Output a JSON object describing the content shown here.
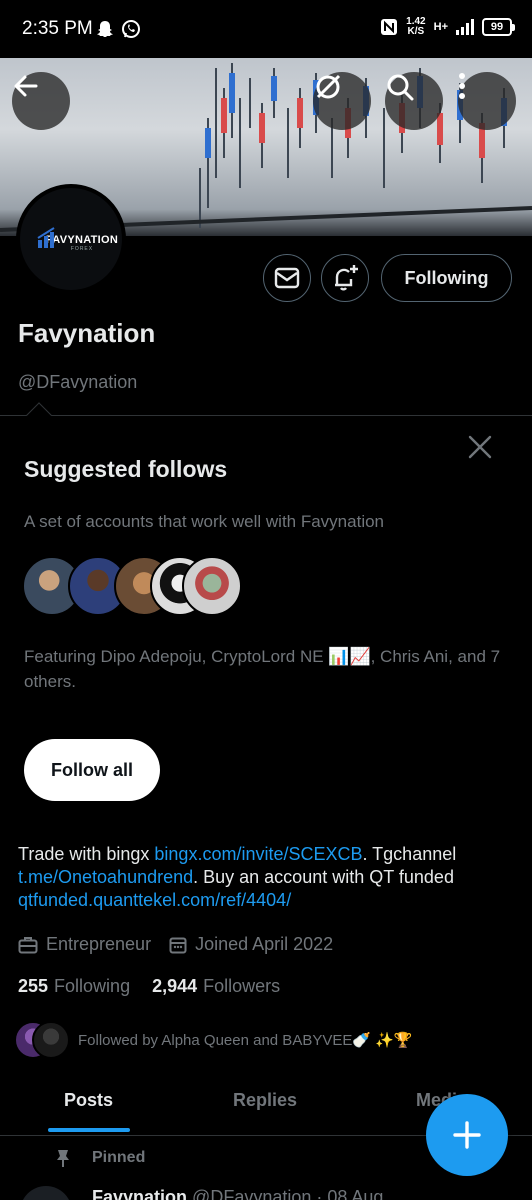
{
  "status": {
    "time": "2:35 PM",
    "speed_top": "1.42",
    "speed_unit": "K/S",
    "network": "H+",
    "battery": "99"
  },
  "profile": {
    "avatar_brand": "FAVYNATION",
    "avatar_sub": "FOREX",
    "name": "Favynation",
    "handle": "@DFavynation",
    "following_label": "Following"
  },
  "suggested": {
    "title": "Suggested follows",
    "subtitle": "A set of accounts that work well with Favynation",
    "featuring": "Featuring Dipo Adepoju, CryptoLord NE 📊📈, Chris Ani, and 7 others.",
    "follow_all_label": "Follow all"
  },
  "bio": {
    "part1": "Trade with bingx ",
    "link1": "bingx.com/invite/SCEXCB",
    "part2": ". Tgchannel ",
    "link2": "t.me/Onetoahundrend",
    "part3": ". Buy an account with QT funded ",
    "link3": "qtfunded.quanttekel.com/ref/4404/"
  },
  "meta": {
    "profession": "Entrepreneur",
    "joined": "Joined April 2022"
  },
  "counts": {
    "following_num": "255",
    "following_label": "Following",
    "followers_num": "2,944",
    "followers_label": "Followers"
  },
  "followed_by": "Followed by Alpha Queen and BABYVEE🍼 ✨🏆",
  "tabs": [
    {
      "label": "Posts"
    },
    {
      "label": "Replies"
    },
    {
      "label": "Medi"
    }
  ],
  "pinned_label": "Pinned",
  "post": {
    "name": "Favynation",
    "handle": "@DFavynation · 08 Aug"
  },
  "colors": {
    "accent": "#1d9bf0",
    "background": "#000000",
    "muted": "#71767b"
  }
}
